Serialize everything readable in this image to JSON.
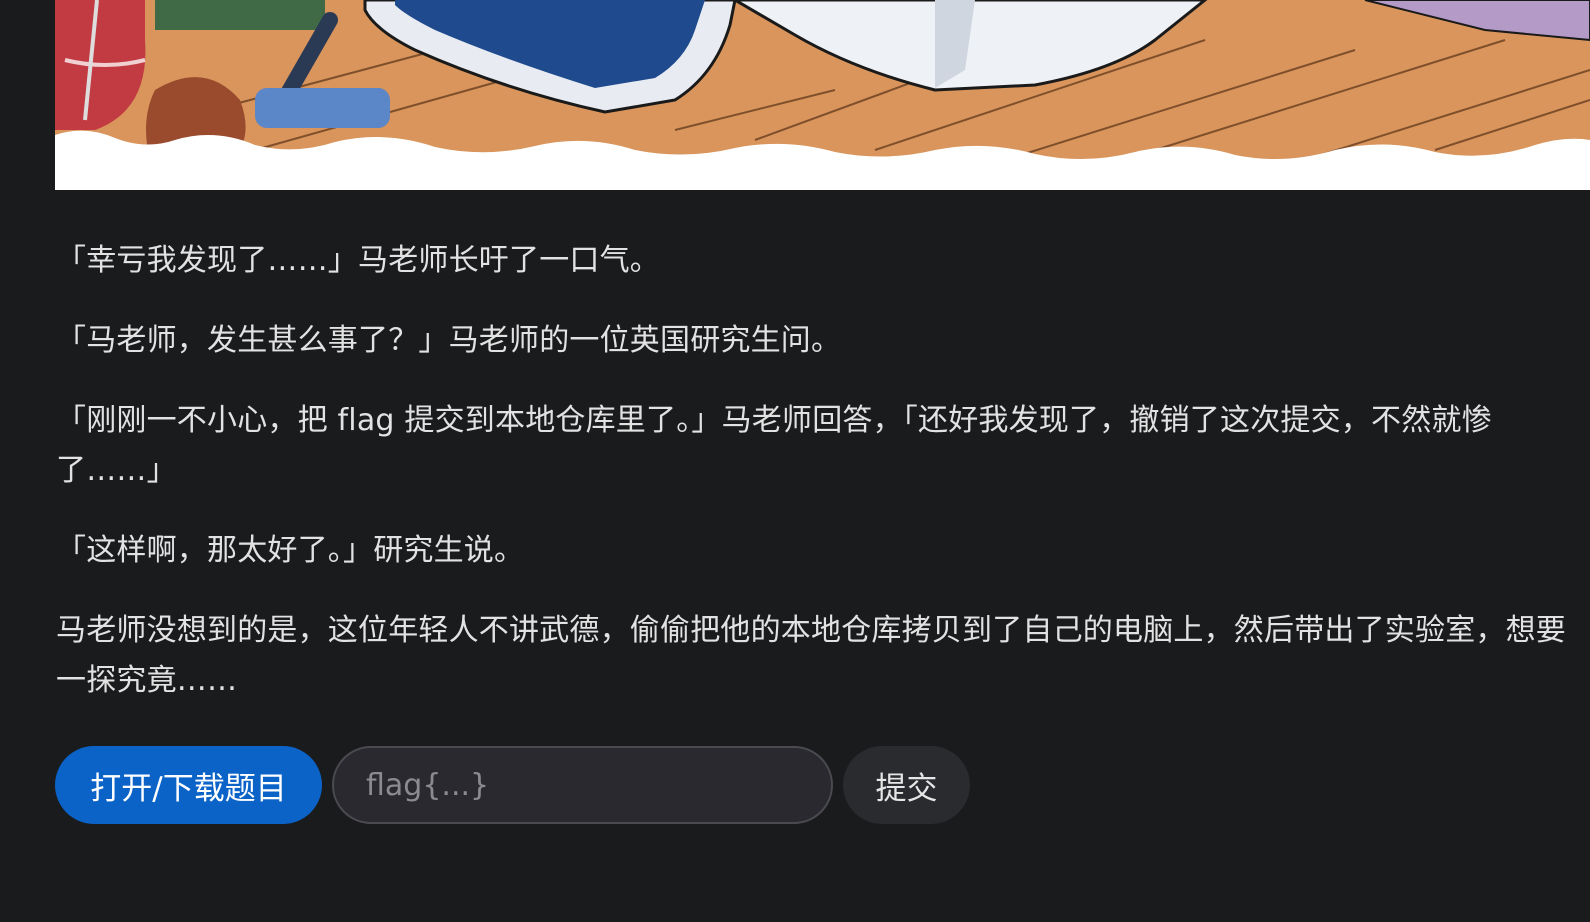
{
  "hero": {
    "image": "comic-illustration-desk-with-tablet-pen-books"
  },
  "story": {
    "paragraphs": [
      "「幸亏我发现了……」马老师长吁了一口气。",
      "「马老师，发生甚么事了？」马老师的一位英国研究生问。",
      "「刚刚一不小心，把 flag 提交到本地仓库里了。」马老师回答，「还好我发现了，撤销了这次提交，不然就惨了……」",
      "「这样啊，那太好了。」研究生说。",
      "马老师没想到的是，这位年轻人不讲武德，偷偷把他的本地仓库拷贝到了自己的电脑上，然后带出了实验室，想要一探究竟……"
    ]
  },
  "actions": {
    "open_label": "打开/下载题目",
    "flag_placeholder": "flag{...}",
    "flag_value": "",
    "submit_label": "提交"
  },
  "colors": {
    "background": "#1a1b1d",
    "primary_button": "#0b63c8",
    "input_background": "#29292f",
    "submit_button": "#2a2b2f"
  }
}
